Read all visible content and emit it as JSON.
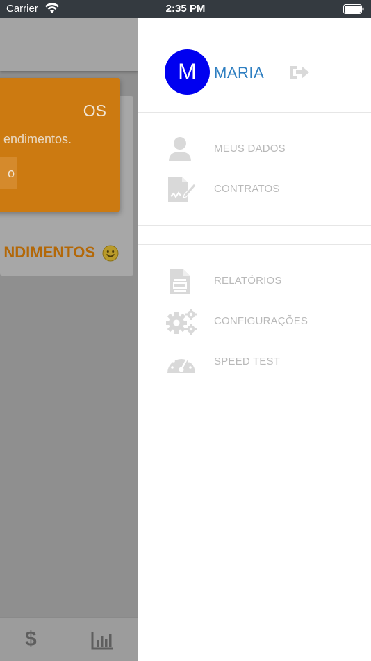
{
  "status_bar": {
    "carrier": "Carrier",
    "time": "2:35 PM"
  },
  "background_app": {
    "promo": {
      "title_fragment": "OS",
      "text_fragment": "endimentos.",
      "button_fragment": "o",
      "color": "#cc7a11"
    },
    "section_title_fragment": "NDIMENTOS",
    "bottom_nav": {
      "dollar_label": "$",
      "icons": [
        "dollar-icon",
        "chart-icon"
      ]
    }
  },
  "drawer": {
    "avatar_initial": "M",
    "avatar_color": "#0000f0",
    "user_name": "MARIA",
    "user_name_color": "#2f7fc1",
    "logout_icon": "logout-icon",
    "menu_primary": [
      {
        "label": "MEUS DADOS",
        "icon": "person-icon"
      },
      {
        "label": "CONTRATOS",
        "icon": "contract-signature-icon"
      }
    ],
    "menu_secondary": [
      {
        "label": "RELATÓRIOS",
        "icon": "report-document-icon"
      },
      {
        "label": "CONFIGURAÇÕES",
        "icon": "gears-icon"
      },
      {
        "label": "SPEED TEST",
        "icon": "speedometer-icon"
      }
    ],
    "menu_text_color": "#b9b9b9",
    "icon_color": "#d9d9d9"
  }
}
